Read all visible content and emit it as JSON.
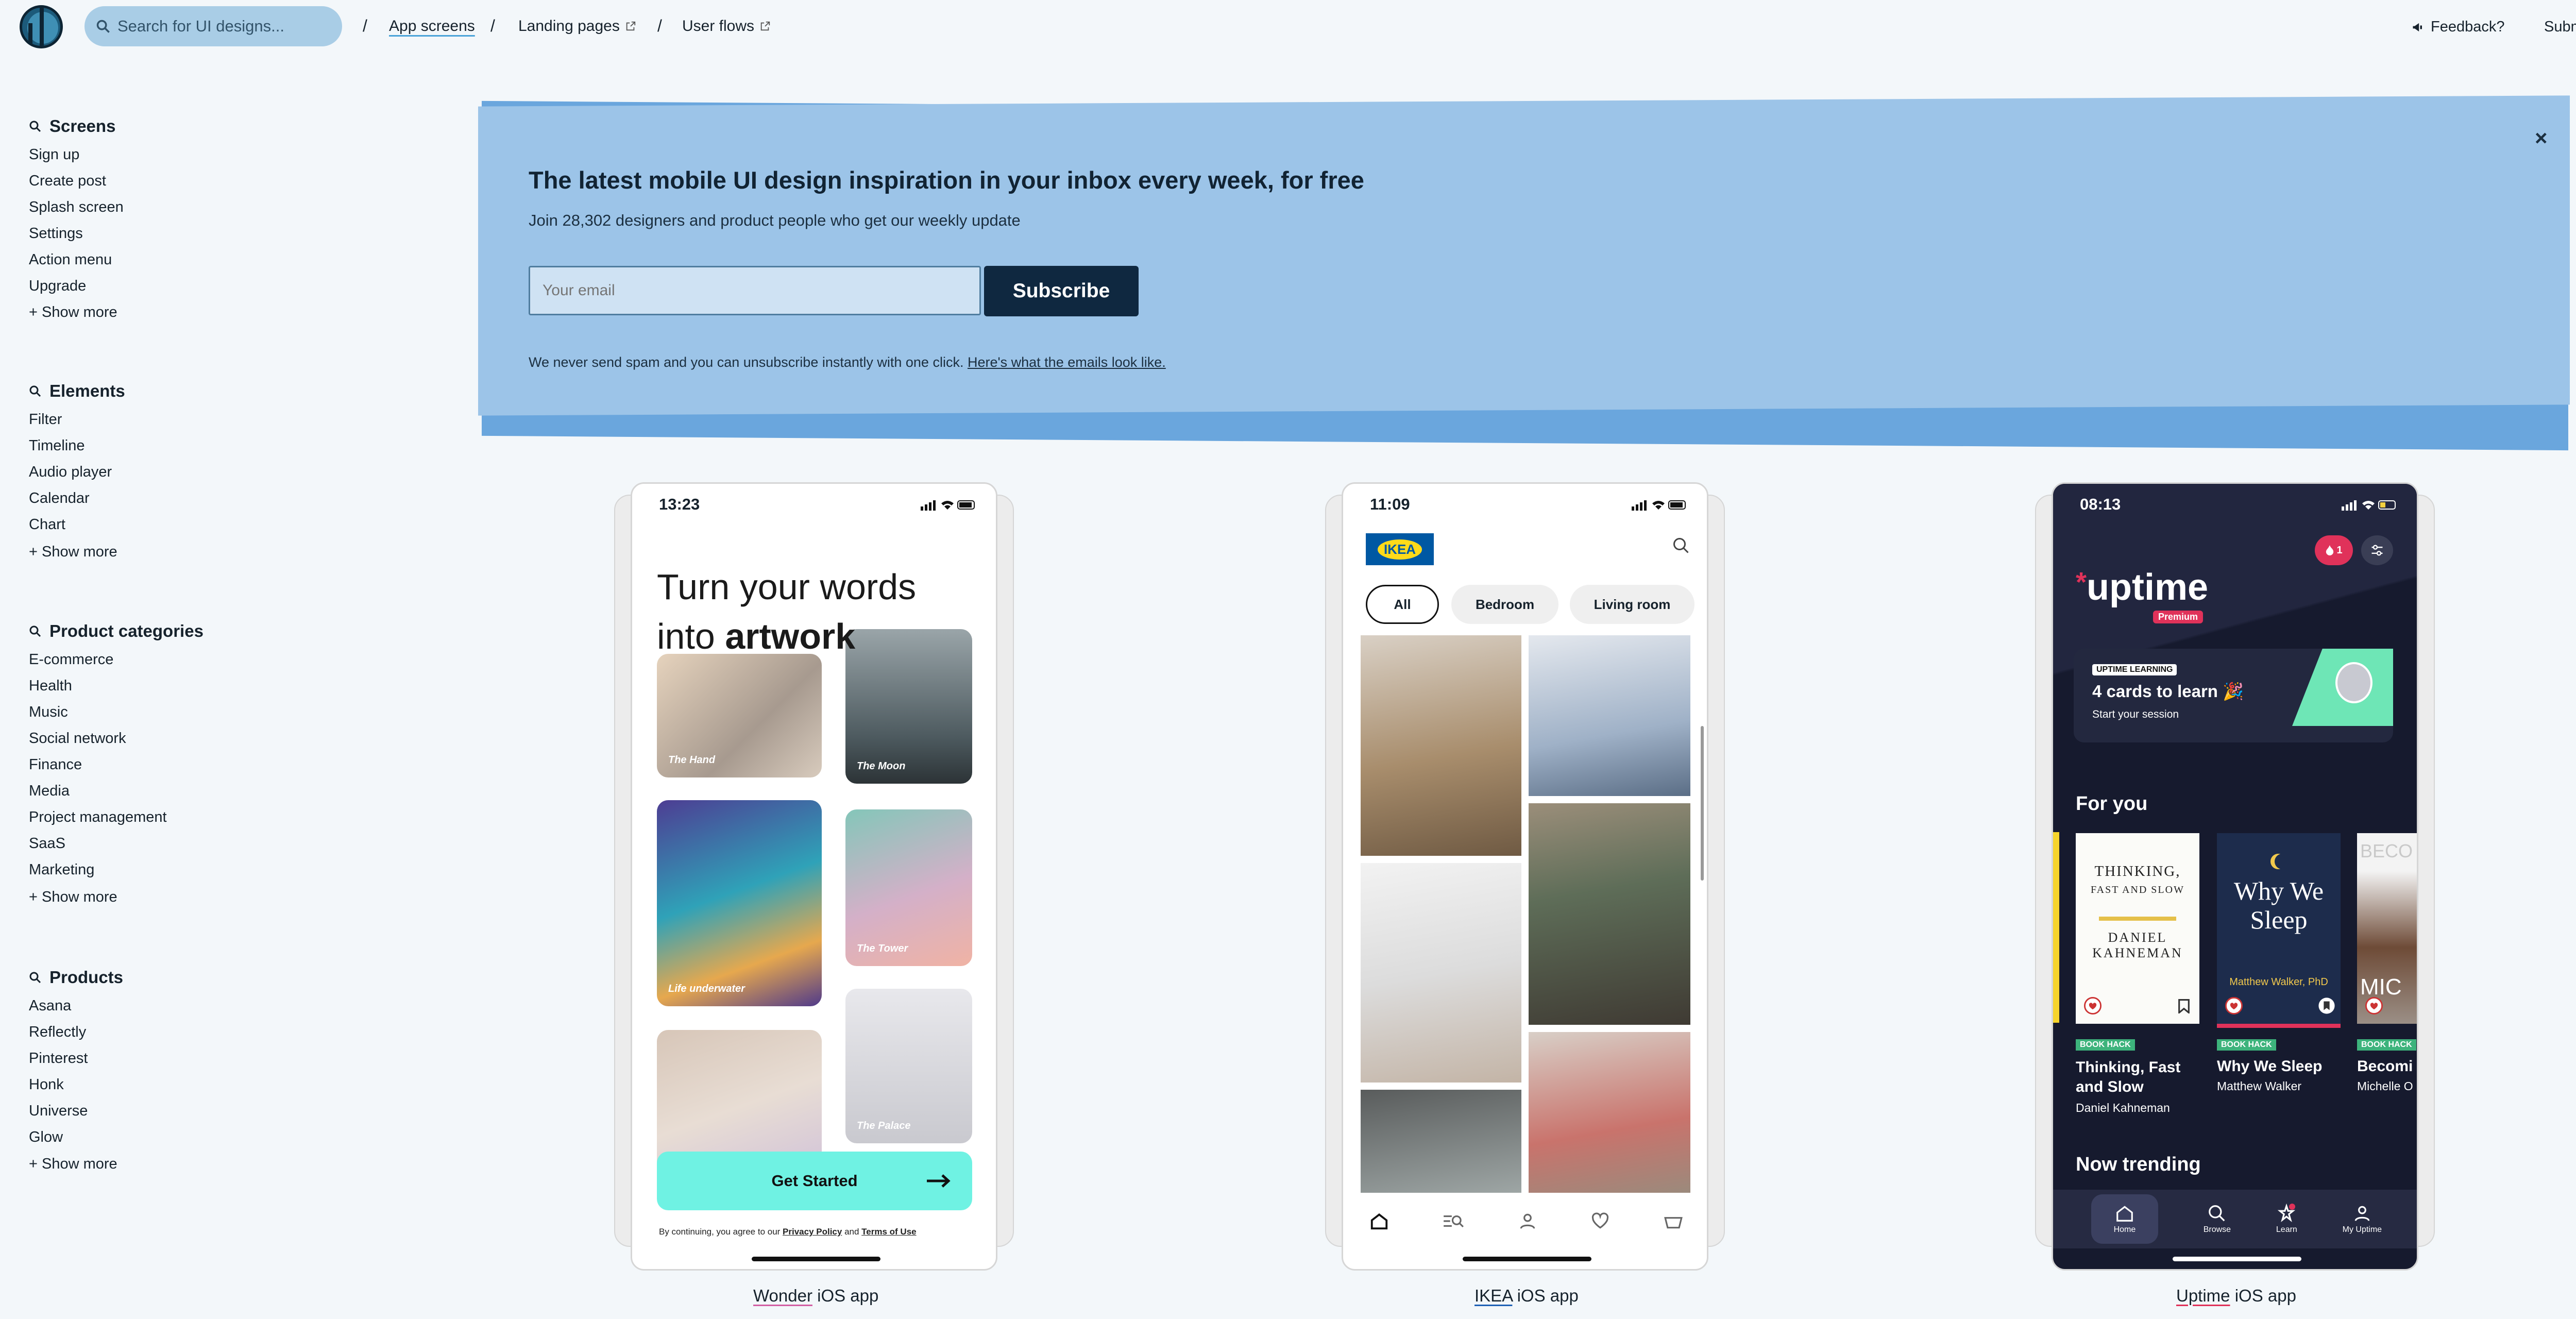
{
  "topbar": {
    "search_placeholder": "Search for UI designs...",
    "crumbs": [
      {
        "label": "App screens"
      },
      {
        "label": "Landing pages"
      },
      {
        "label": "User flows"
      }
    ],
    "separator": "/",
    "feedback": "Feedback?",
    "submit": "Submit"
  },
  "sidebar": {
    "show_more": "+ Show more",
    "screens": {
      "title": "Screens",
      "items": [
        "Sign up",
        "Create post",
        "Splash screen",
        "Settings",
        "Action menu",
        "Upgrade"
      ]
    },
    "elements": {
      "title": "Elements",
      "items": [
        "Filter",
        "Timeline",
        "Audio player",
        "Calendar",
        "Chart"
      ]
    },
    "categories": {
      "title": "Product categories",
      "items": [
        "E-commerce",
        "Health",
        "Music",
        "Social network",
        "Finance",
        "Media",
        "Project management",
        "SaaS",
        "Marketing"
      ]
    },
    "products": {
      "title": "Products",
      "items": [
        "Asana",
        "Reflectly",
        "Pinterest",
        "Honk",
        "Universe",
        "Glow"
      ]
    }
  },
  "banner": {
    "title": "The latest mobile UI design inspiration in your inbox every week, for free",
    "subtitle": "Join 28,302 designers and product people who get our weekly update",
    "email_placeholder": "Your email",
    "subscribe": "Subscribe",
    "spam_note": "We never send spam and you can unsubscribe instantly with one click.",
    "spam_link": "Here's what the emails look like.",
    "close": "×"
  },
  "apps": [
    {
      "name": "Wonder",
      "suffix": "iOS app",
      "underline_color": "#d25fa4",
      "time": "13:23",
      "headline_1": "Turn your words",
      "headline_2a": "into ",
      "headline_2b": "artwork",
      "tiles": [
        "The Hand",
        "The Moon",
        "Life underwater",
        "The Tower",
        "",
        "The Palace"
      ],
      "cta": "Get Started",
      "legal_pre": "By continuing, you agree to our ",
      "legal_privacy": "Privacy Policy",
      "legal_and": " and ",
      "legal_terms": "Terms of Use"
    },
    {
      "name": "IKEA",
      "suffix": "iOS app",
      "underline_color": "#1f61b5",
      "time": "11:09",
      "logo": "IKEA",
      "chips": [
        "All",
        "Bedroom",
        "Living room"
      ],
      "tabs": [
        "home-icon",
        "browse-icon",
        "profile-icon",
        "heart-icon",
        "cart-icon"
      ]
    },
    {
      "name": "Uptime",
      "suffix": "iOS app",
      "underline_color": "#e0325a",
      "time": "08:13",
      "badge_count": "1",
      "brand": "uptime",
      "premium": "Premium",
      "learning_tag": "UPTIME LEARNING",
      "learning_title": "4 cards to learn 🎉",
      "learning_sub": "Start your session",
      "for_you": "For you",
      "books": [
        {
          "tag": "BOOK HACK",
          "title": "Thinking, Fast and Slow",
          "author": "Daniel Kahneman",
          "cover_1": "THINKING,",
          "cover_2": "FAST AND SLOW",
          "cover_3": "DANIEL KAHNEMAN"
        },
        {
          "tag": "BOOK HACK",
          "title": "Why We Sleep",
          "author": "Matthew Walker",
          "cover_1": "Why We",
          "cover_2": "Sleep",
          "cover_3": "Matthew Walker, PhD"
        },
        {
          "tag": "BOOK HACK",
          "title": "Becomi",
          "author": "Michelle O",
          "cover_1": "BECO",
          "cover_2": "MIC",
          "cover_3": ""
        }
      ],
      "now_trending": "Now trending",
      "tabs": [
        "Home",
        "Browse",
        "Learn",
        "My Uptime"
      ]
    }
  ]
}
